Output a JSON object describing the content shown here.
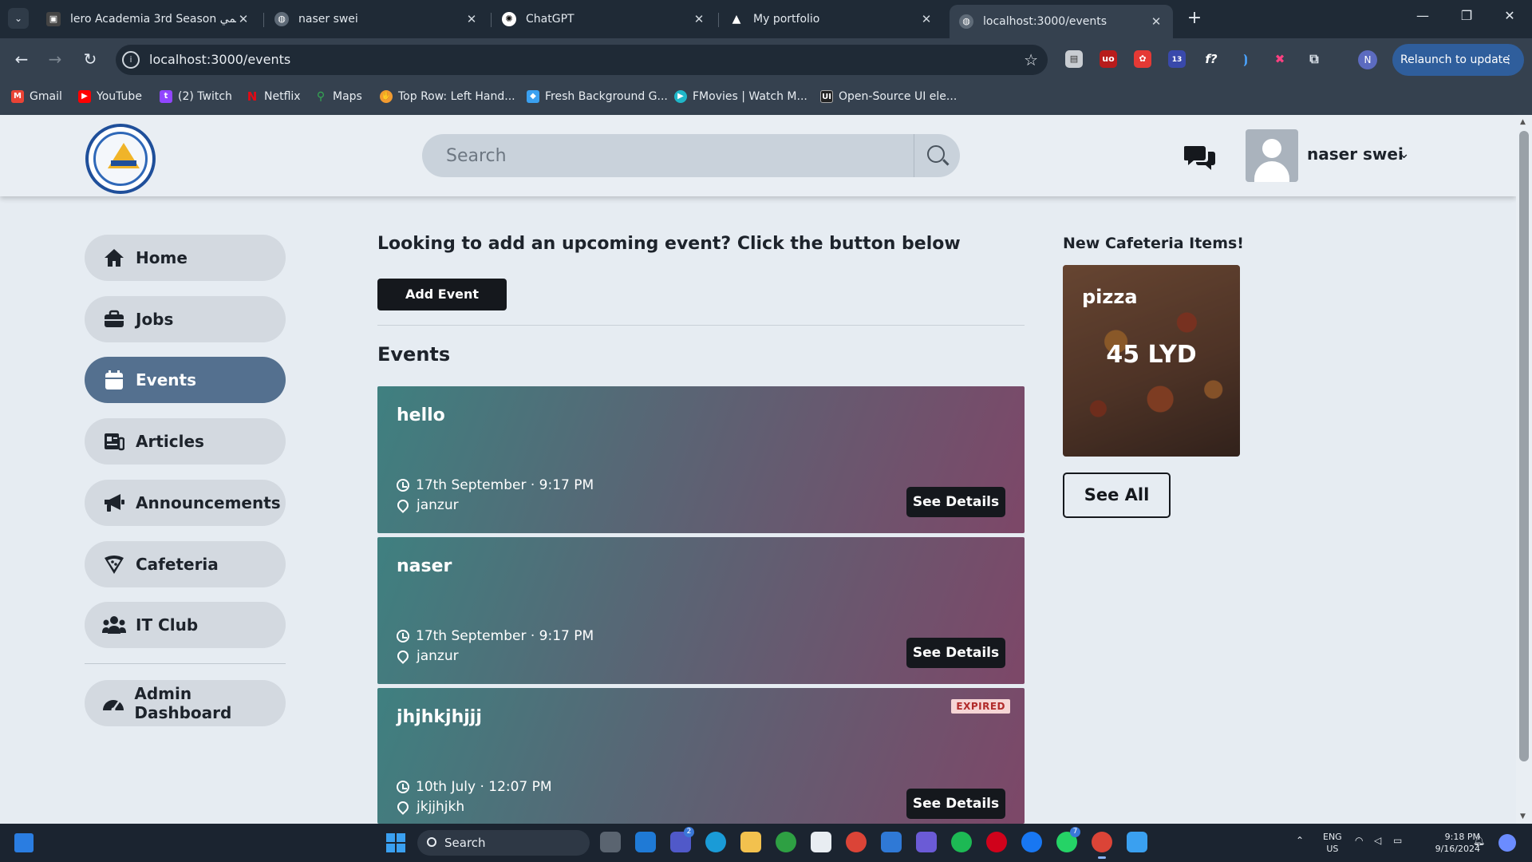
{
  "browser": {
    "tabs": [
      {
        "title": "lero Academia 3rd Season أنمي",
        "favicon": "anime-site-icon"
      },
      {
        "title": "naser swei",
        "favicon": "globe-icon"
      },
      {
        "title": "ChatGPT",
        "favicon": "chatgpt-icon"
      },
      {
        "title": "My portfolio",
        "favicon": "triangle-logo-icon"
      },
      {
        "title": "localhost:3000/events",
        "favicon": "globe-icon"
      }
    ],
    "active_tab": 4,
    "url": "localhost:3000/events",
    "profile_initial": "N",
    "relaunch_label": "Relaunch to update",
    "extension_badge": "13",
    "bookmarks": [
      {
        "label": "Gmail",
        "icon": "gmail-icon",
        "color": "#ea4335"
      },
      {
        "label": "YouTube",
        "icon": "youtube-icon",
        "color": "#ff0000"
      },
      {
        "label": "(2) Twitch",
        "icon": "twitch-icon",
        "color": "#9146ff"
      },
      {
        "label": "Netflix",
        "icon": "netflix-icon",
        "color": "#e50914"
      },
      {
        "label": "Maps",
        "icon": "maps-icon",
        "color": "#34a853"
      },
      {
        "label": "Top Row: Left Hand...",
        "icon": "hand-icon",
        "color": "#f29b30"
      },
      {
        "label": "Fresh Background G...",
        "icon": "background-icon",
        "color": "#3aa0f0"
      },
      {
        "label": "FMovies | Watch M...",
        "icon": "play-icon",
        "color": "#1fb7c9"
      },
      {
        "label": "Open-Source UI ele...",
        "icon": "ui-icon",
        "color": "#222222"
      }
    ]
  },
  "header": {
    "search_placeholder": "Search",
    "user_name": "naser swei"
  },
  "sidebar": {
    "items": [
      {
        "label": "Home",
        "icon": "home-icon",
        "active": false
      },
      {
        "label": "Jobs",
        "icon": "briefcase-icon",
        "active": false
      },
      {
        "label": "Events",
        "icon": "calendar-icon",
        "active": true
      },
      {
        "label": "Articles",
        "icon": "newspaper-icon",
        "active": false
      },
      {
        "label": "Announcements",
        "icon": "megaphone-icon",
        "active": false
      },
      {
        "label": "Cafeteria",
        "icon": "pizza-icon",
        "active": false
      },
      {
        "label": "IT Club",
        "icon": "people-icon",
        "active": false
      }
    ],
    "admin": {
      "label": "Admin Dashboard",
      "icon": "gauge-icon"
    }
  },
  "main": {
    "cta_text": "Looking to add an upcoming event? Click the button below",
    "add_event_label": "Add Event",
    "events_title": "Events",
    "see_details_label": "See Details",
    "events": [
      {
        "name": "hello",
        "date": "17th September · 9:17 PM",
        "location": "janzur",
        "expired": false
      },
      {
        "name": "naser",
        "date": "17th September · 9:17 PM",
        "location": "janzur",
        "expired": false
      },
      {
        "name": "jhjhkjhjjj",
        "date": "10th July · 12:07 PM",
        "location": "jkjjhjkh",
        "expired": true,
        "badge": "EXPIRED"
      }
    ]
  },
  "cafeteria": {
    "title": "New Cafeteria Items!",
    "item_name": "pizza",
    "item_price": "45 LYD",
    "see_all_label": "See All"
  },
  "taskbar": {
    "search_label": "Search",
    "lang_line1": "ENG",
    "lang_line2": "US",
    "time": "9:18 PM",
    "date": "9/16/2024",
    "teams_badge": "2",
    "whatsapp_badge": "7"
  },
  "colors": {
    "active_nav": "#54708f",
    "card_gradient_start": "#3f8080",
    "card_gradient_end": "#7d4768",
    "button_dark": "#15181d"
  }
}
